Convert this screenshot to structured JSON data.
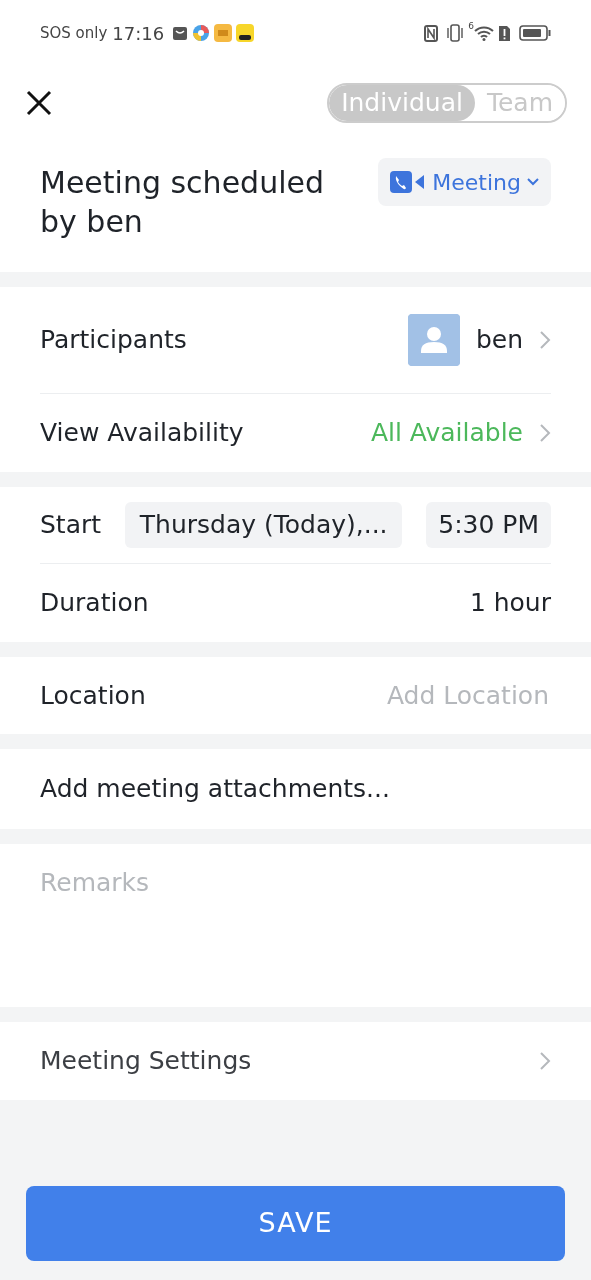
{
  "status_bar": {
    "carrier": "SOS only",
    "time": "17:16",
    "network_label": "6"
  },
  "header": {
    "tabs": [
      {
        "label": "Individual",
        "selected": true
      },
      {
        "label": "Team",
        "selected": false
      }
    ]
  },
  "title": "Meeting scheduled by ben",
  "type_button": {
    "label": "Meeting"
  },
  "participants": {
    "label": "Participants",
    "name": "ben"
  },
  "availability": {
    "label": "View Availability",
    "value": "All Available"
  },
  "start": {
    "label": "Start",
    "date": "Thursday (Today),...",
    "time": "5:30 PM"
  },
  "duration": {
    "label": "Duration",
    "value": "1 hour"
  },
  "location": {
    "label": "Location",
    "placeholder": "Add Location"
  },
  "attachments": {
    "label": "Add meeting attachments..."
  },
  "remarks": {
    "placeholder": "Remarks"
  },
  "settings": {
    "label": "Meeting Settings"
  },
  "save_button": {
    "label": "SAVE"
  }
}
